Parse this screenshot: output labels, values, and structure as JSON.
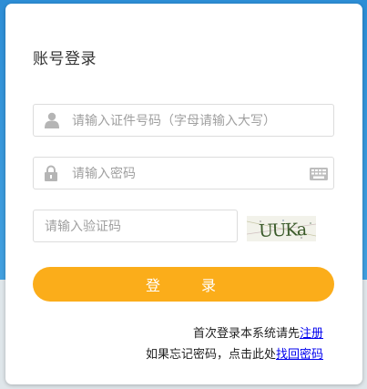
{
  "title": "账号登录",
  "username": {
    "placeholder": "请输入证件号码（字母请输入大写）",
    "value": ""
  },
  "password": {
    "placeholder": "请输入密码",
    "value": ""
  },
  "captcha": {
    "placeholder": "请输入验证码",
    "value": "",
    "image_text": "UUKa"
  },
  "login_button": "登 录",
  "register": {
    "text": "首次登录本系统请先",
    "link": "注册"
  },
  "recover": {
    "text": "如果忘记密码，点击此处",
    "link": "找回密码"
  },
  "colors": {
    "accent": "#fbad1a",
    "link": "#0000ee",
    "background": "#3a95d3"
  }
}
